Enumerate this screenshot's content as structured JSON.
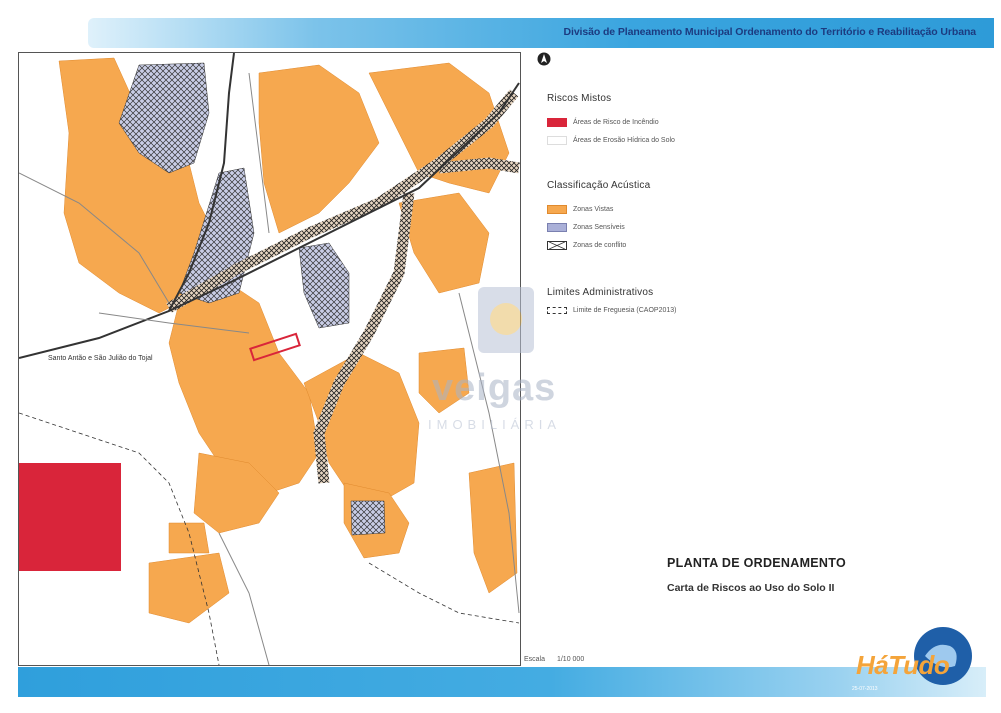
{
  "header": {
    "title": "Divisão de Planeamento Municipal Ordenamento do Território e Reabilitação Urbana"
  },
  "legend": {
    "groups": [
      {
        "title": "Riscos Mistos",
        "items": [
          {
            "label": "Áreas de Risco de Incêndio",
            "color": "#d9253a"
          },
          {
            "label": "Áreas de Erosão Hídrica do Solo",
            "color": "#ffffff"
          }
        ]
      },
      {
        "title": "Classificação Acústica",
        "items": [
          {
            "label": "Zonas Vistas",
            "color": "#f6a84f"
          },
          {
            "label": "Zonas Sensíveis",
            "color": "#aab0d8"
          },
          {
            "label": "Zonas de conflito",
            "color": "#ffffff"
          }
        ]
      },
      {
        "title": "Limites Administrativos",
        "items": [
          {
            "label": "Limite de Freguesia (CAOP2013)",
            "color": "#ffffff"
          }
        ]
      }
    ]
  },
  "map": {
    "place_label": "Santo Antão e São Julião do Tojal",
    "scale_label": "Escala",
    "scale_value": "1/10 000"
  },
  "title_block": {
    "title": "PLANTA DE ORDENAMENTO",
    "subtitle": "Carta de Riscos ao Uso do Solo II"
  },
  "watermark": {
    "brand": "veigas",
    "sub": "IMOBILIÁRIA"
  },
  "logo": {
    "brand": "HáTudo",
    "date": "25-07-2013"
  }
}
